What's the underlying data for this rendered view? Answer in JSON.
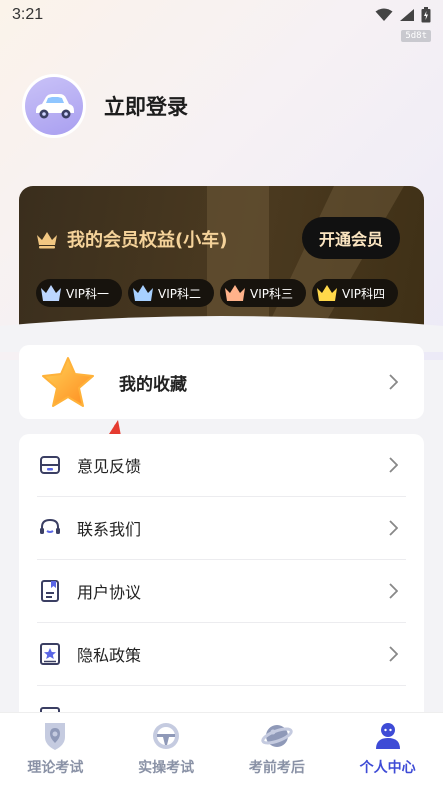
{
  "status_bar": {
    "time": "3:21",
    "debug_tag": "5d8t"
  },
  "profile": {
    "login_text": "立即登录"
  },
  "vip": {
    "title": "我的会员权益(小车)",
    "open_button": "开通会员",
    "chips": [
      {
        "label": "VIP科一",
        "color": "#bcd6ff"
      },
      {
        "label": "VIP科二",
        "color": "#a7d0ff"
      },
      {
        "label": "VIP科三",
        "color": "#ffb28a"
      },
      {
        "label": "VIP科四",
        "color": "#ffd84a"
      }
    ]
  },
  "favorites": {
    "label": "我的收藏"
  },
  "menu": {
    "items": [
      {
        "label": "意见反馈",
        "icon": "feedback-icon"
      },
      {
        "label": "联系我们",
        "icon": "headset-icon"
      },
      {
        "label": "用户协议",
        "icon": "document-icon"
      },
      {
        "label": "隐私政策",
        "icon": "privacy-icon"
      }
    ]
  },
  "tabs": [
    {
      "label": "理论考试",
      "icon": "pen-icon",
      "active": false
    },
    {
      "label": "实操考试",
      "icon": "steering-wheel-icon",
      "active": false
    },
    {
      "label": "考前考后",
      "icon": "planet-icon",
      "active": false
    },
    {
      "label": "个人中心",
      "icon": "user-icon",
      "active": true
    }
  ],
  "colors": {
    "accent": "#3e4bd6",
    "vip_gold": "#f5d39a",
    "annotation_red": "#e53b30"
  }
}
